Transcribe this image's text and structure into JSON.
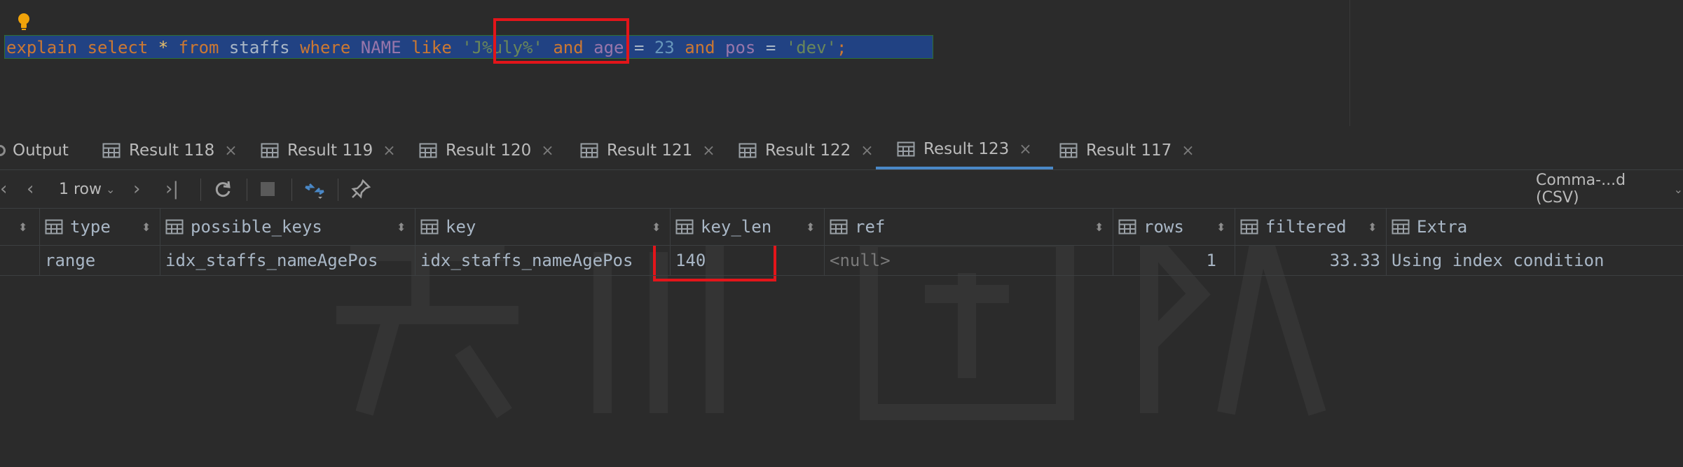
{
  "editor": {
    "tokens": [
      {
        "t": "explain",
        "c": "kw"
      },
      {
        "t": " ",
        "c": "op"
      },
      {
        "t": "select",
        "c": "kw"
      },
      {
        "t": " ",
        "c": "op"
      },
      {
        "t": "*",
        "c": "star"
      },
      {
        "t": " ",
        "c": "op"
      },
      {
        "t": "from",
        "c": "kw"
      },
      {
        "t": " ",
        "c": "op"
      },
      {
        "t": "staffs",
        "c": "id"
      },
      {
        "t": " ",
        "c": "op"
      },
      {
        "t": "where",
        "c": "kw"
      },
      {
        "t": " ",
        "c": "op"
      },
      {
        "t": "NAME",
        "c": "col"
      },
      {
        "t": " ",
        "c": "op"
      },
      {
        "t": "like",
        "c": "kw"
      },
      {
        "t": " ",
        "c": "op"
      },
      {
        "t": "'J%uly%'",
        "c": "str"
      },
      {
        "t": " ",
        "c": "op"
      },
      {
        "t": "and",
        "c": "kw"
      },
      {
        "t": " ",
        "c": "op"
      },
      {
        "t": "age",
        "c": "col"
      },
      {
        "t": " = ",
        "c": "op"
      },
      {
        "t": "23",
        "c": "num"
      },
      {
        "t": " ",
        "c": "op"
      },
      {
        "t": "and",
        "c": "kw"
      },
      {
        "t": " ",
        "c": "op"
      },
      {
        "t": "pos",
        "c": "col"
      },
      {
        "t": " = ",
        "c": "op"
      },
      {
        "t": "'dev'",
        "c": "str"
      },
      {
        "t": ";",
        "c": "punct"
      }
    ],
    "intention_icon": "lightbulb-icon"
  },
  "tabs": {
    "output_label": "Output",
    "items": [
      {
        "label": "Result 118",
        "active": false
      },
      {
        "label": "Result 119",
        "active": false
      },
      {
        "label": "Result 120",
        "active": false
      },
      {
        "label": "Result 121",
        "active": false
      },
      {
        "label": "Result 122",
        "active": false
      },
      {
        "label": "Result 123",
        "active": true
      },
      {
        "label": "Result 117",
        "active": false
      }
    ],
    "close_glyph": "×"
  },
  "toolbar": {
    "row_count": "1 row",
    "export_format": "Comma-...d (CSV)"
  },
  "grid": {
    "columns": [
      "type",
      "possible_keys",
      "key",
      "key_len",
      "ref",
      "rows",
      "filtered",
      "Extra"
    ],
    "row": {
      "type": "range",
      "possible_keys": "idx_staffs_nameAgePos",
      "key": "idx_staffs_nameAgePos",
      "key_len": "140",
      "ref": "<null>",
      "rows": "1",
      "filtered": "33.33",
      "extra": "Using index condition"
    }
  },
  "colors": {
    "accent": "#4a88c7",
    "highlight_box": "#e3151a",
    "editor_selection": "#214283"
  }
}
